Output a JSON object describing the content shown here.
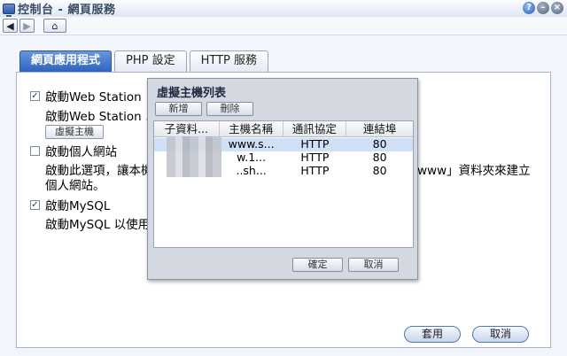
{
  "window": {
    "title": "控制台 - 網頁服務"
  },
  "icons": {
    "app": "control-panel-icon",
    "help": "help-icon",
    "minimize": "minimize-icon",
    "close": "close-icon",
    "back": "back-arrow-icon",
    "forward": "forward-arrow-icon",
    "home": "home-icon"
  },
  "toolbar": {
    "back": "◀",
    "forward": "▶",
    "home": "⌂"
  },
  "tabs": [
    {
      "label": "網頁應用程式"
    },
    {
      "label": "PHP 設定"
    },
    {
      "label": "HTTP 服務"
    }
  ],
  "options": {
    "web_station": {
      "label": "啟動Web Station",
      "checked": true,
      "desc": "啟動Web Station 以"
    },
    "virtual_host_button": "虛擬主機",
    "personal_site": {
      "label": "啟動個人網站",
      "checked": false,
      "desc_line1_left": "啟動此選項，讓本機",
      "desc_line1_right": "www」資料夾來建立",
      "desc_line2": "個人網站。"
    },
    "mysql": {
      "label": "啟動MySQL",
      "checked": true,
      "desc": "啟動MySQL 以使用l"
    }
  },
  "footer": {
    "apply": "套用",
    "cancel": "取消"
  },
  "dialog": {
    "title": "虛擬主機列表",
    "add": "新增",
    "delete": "刪除",
    "ok": "確定",
    "cancel": "取消",
    "columns": [
      "子資料...",
      "主機名稱",
      "通訊協定",
      "連結埠"
    ],
    "rows": [
      {
        "folder": "",
        "host": "www.s...",
        "protocol": "HTTP",
        "port": "80"
      },
      {
        "folder": "",
        "host": "w.1...",
        "protocol": "HTTP",
        "port": "80"
      },
      {
        "folder": "",
        "host": "..sh...",
        "protocol": "HTTP",
        "port": "80"
      }
    ]
  }
}
